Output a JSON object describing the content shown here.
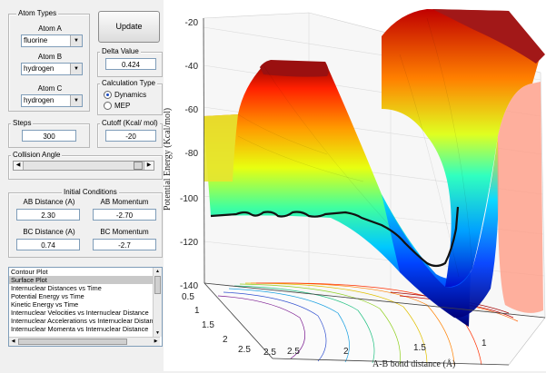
{
  "atom_types": {
    "title": "Atom Types",
    "atom_a_label": "Atom A",
    "atom_a_value": "fluorine",
    "atom_b_label": "Atom B",
    "atom_b_value": "hydrogen",
    "atom_c_label": "Atom C",
    "atom_c_value": "hydrogen"
  },
  "update_label": "Update",
  "delta": {
    "title": "Delta Value",
    "value": "0.424"
  },
  "calc_type": {
    "title": "Calculation Type",
    "options": [
      "Dynamics",
      "MEP"
    ],
    "selected": "Dynamics"
  },
  "steps": {
    "title": "Steps",
    "value": "300"
  },
  "cutoff": {
    "title": "Cutoff (Kcal/ mol)",
    "value": "-20"
  },
  "collision": {
    "title": "Collision Angle"
  },
  "initial": {
    "title": "Initial Conditions",
    "ab_dist_label": "AB Distance (A)",
    "ab_dist": "2.30",
    "ab_mom_label": "AB Momentum",
    "ab_mom": "-2.70",
    "bc_dist_label": "BC Distance (A)",
    "bc_dist": "0.74",
    "bc_mom_label": "BC Momentum",
    "bc_mom": "-2.7"
  },
  "plot_list": [
    "Contour Plot",
    "Surface Plot",
    "Internuclear Distances vs Time",
    "Potential Energy vs Time",
    "Kinetic Energy vs Time",
    "Internuclear Velocities vs Internuclear Distance",
    "Internuclear Accelerations vs Internuclear Distance",
    "Internuclear Momenta vs Internuclear Distance"
  ],
  "plot_list_selected": "Surface Plot",
  "plot": {
    "z_label": "Potential Energy (Kcal/mol)",
    "x_label": "A-B bond distance (Å)",
    "z_ticks": [
      "-20",
      "-40",
      "-60",
      "-80",
      "-100",
      "-120",
      "-140"
    ],
    "x_ticks": [
      "0.5",
      "1",
      "1.5",
      "2",
      "2.5"
    ],
    "y_ticks": [
      "0.5",
      "1",
      "1.5",
      "2",
      "2.5"
    ],
    "x_axis_ticks": [
      "2.5",
      "2",
      "1.5",
      "1"
    ]
  }
}
